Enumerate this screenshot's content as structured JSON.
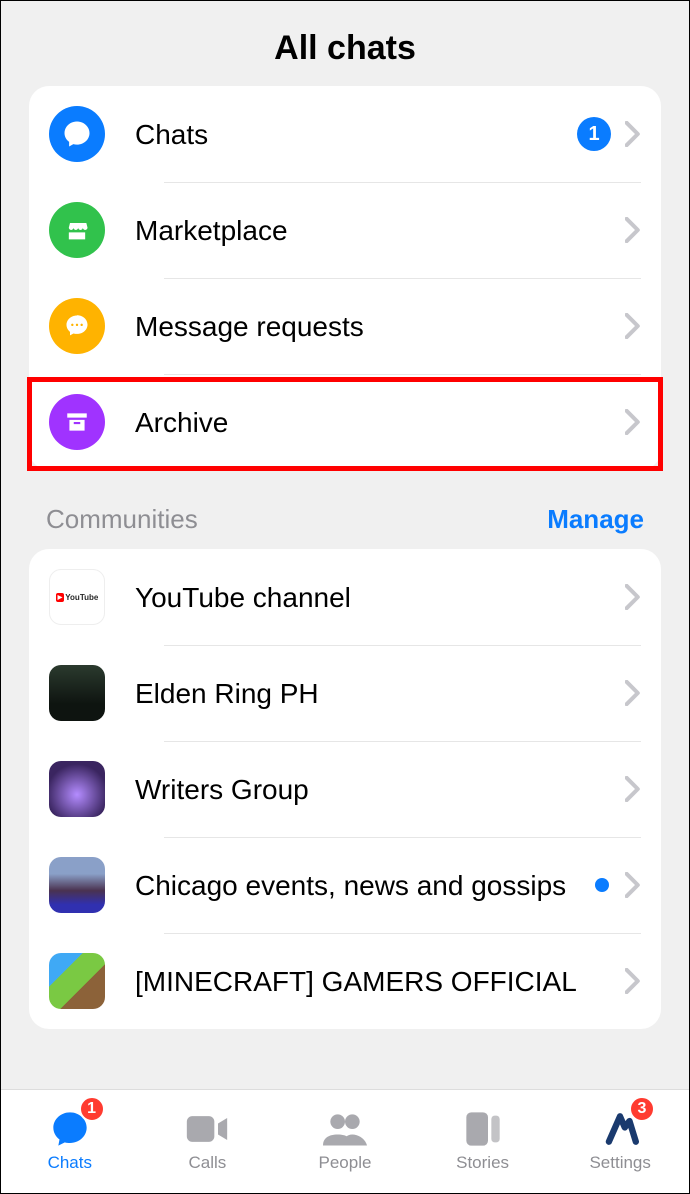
{
  "header": {
    "title": "All chats"
  },
  "folders": [
    {
      "id": "chats",
      "label": "Chats",
      "badge": "1",
      "color": "#0a7cff"
    },
    {
      "id": "marketplace",
      "label": "Marketplace",
      "color": "#31c24c"
    },
    {
      "id": "message-requests",
      "label": "Message requests",
      "color": "#ffb300"
    },
    {
      "id": "archive",
      "label": "Archive",
      "color": "#a033ff",
      "highlighted": true
    }
  ],
  "communities_section": {
    "title": "Communities",
    "manage_label": "Manage"
  },
  "communities": [
    {
      "id": "youtube",
      "label": "YouTube channel"
    },
    {
      "id": "eldenring",
      "label": "Elden Ring PH"
    },
    {
      "id": "writers",
      "label": "Writers Group"
    },
    {
      "id": "chicago",
      "label": "Chicago  events, news and gossips",
      "unread": true
    },
    {
      "id": "minecraft",
      "label": "[MINECRAFT] GAMERS OFFICIAL"
    }
  ],
  "tabs": {
    "chats": {
      "label": "Chats",
      "badge": "1",
      "active": true
    },
    "calls": {
      "label": "Calls"
    },
    "people": {
      "label": "People"
    },
    "stories": {
      "label": "Stories"
    },
    "settings": {
      "label": "Settings",
      "badge": "3"
    }
  }
}
